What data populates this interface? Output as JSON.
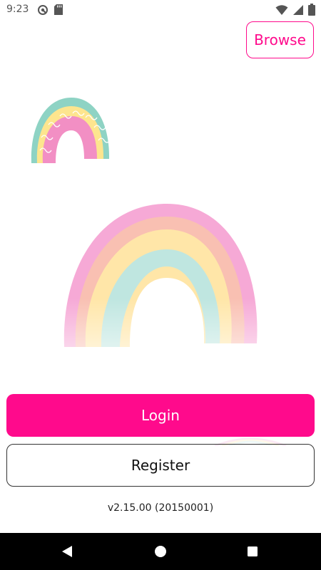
{
  "status_bar": {
    "time": "9:23",
    "left_icons": [
      "sync-icon",
      "sd-card-icon"
    ],
    "right_icons": [
      "wifi-icon",
      "signal-icon",
      "battery-icon"
    ]
  },
  "header": {
    "browse_label": "Browse"
  },
  "auth": {
    "login_label": "Login",
    "register_label": "Register"
  },
  "footer": {
    "version": "v2.15.00 (20150001)"
  },
  "nav_bar": {
    "buttons": [
      "back-icon",
      "home-icon",
      "recents-icon"
    ]
  },
  "colors": {
    "accent": "#ff0a8c",
    "rainbow_pink": "#f6a9d6",
    "rainbow_peach": "#f9c0b2",
    "rainbow_yellow": "#ffe6a8",
    "rainbow_teal": "#bfe6e0"
  }
}
